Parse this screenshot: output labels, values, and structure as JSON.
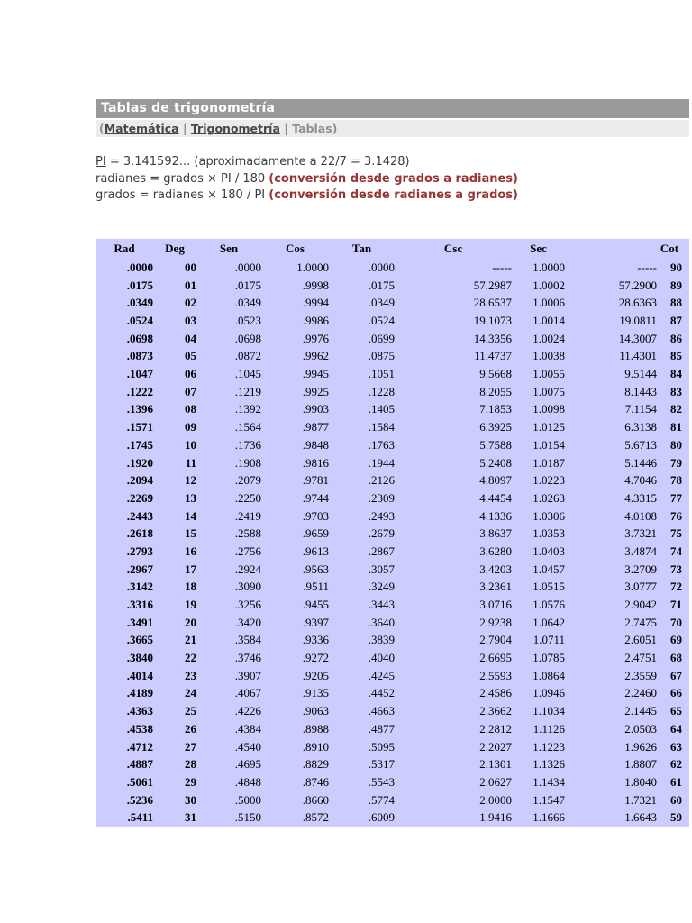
{
  "page": {
    "title": "Tablas de trigonometría"
  },
  "breadcrumb": {
    "open_paren": "(",
    "links": [
      {
        "label": "Matemática"
      },
      {
        "label": "Trigonometría"
      }
    ],
    "separator": " | ",
    "current": "Tablas",
    "close_paren": ")"
  },
  "intro": {
    "pi_link": "PI",
    "pi_rest": " = 3.141592... (aproximadamente a 22/7 = 3.1428)",
    "line2_formula": "radianes = grados × PI / 180 ",
    "line2_note": "(conversión desde grados a radianes)",
    "line3_formula": "grados = radianes × 180 / PI ",
    "line3_note": "(conversión desde radianes a grados)"
  },
  "colors": {
    "title_bar_bg": "#999999",
    "title_text": "#ffffff",
    "breadcrumb_bg": "#ececec",
    "table_bg": "#ccccff",
    "note_red": "#993333",
    "body_text": "#3c3c3c"
  },
  "table": {
    "headers": [
      "Rad",
      "Deg",
      "Sen",
      "Cos",
      "Tan",
      "Csc",
      "Sec",
      "",
      "Cot"
    ],
    "bold_columns": [
      0,
      1,
      8
    ],
    "rows": [
      [
        ".0000",
        "00",
        ".0000",
        "1.0000",
        ".0000",
        "-----",
        "1.0000",
        "-----",
        "90"
      ],
      [
        ".0175",
        "01",
        ".0175",
        ".9998",
        ".0175",
        "57.2987",
        "1.0002",
        "57.2900",
        "89"
      ],
      [
        ".0349",
        "02",
        ".0349",
        ".9994",
        ".0349",
        "28.6537",
        "1.0006",
        "28.6363",
        "88"
      ],
      [
        ".0524",
        "03",
        ".0523",
        ".9986",
        ".0524",
        "19.1073",
        "1.0014",
        "19.0811",
        "87"
      ],
      [
        ".0698",
        "04",
        ".0698",
        ".9976",
        ".0699",
        "14.3356",
        "1.0024",
        "14.3007",
        "86"
      ],
      [
        ".0873",
        "05",
        ".0872",
        ".9962",
        ".0875",
        "11.4737",
        "1.0038",
        "11.4301",
        "85"
      ],
      [
        ".1047",
        "06",
        ".1045",
        ".9945",
        ".1051",
        "9.5668",
        "1.0055",
        "9.5144",
        "84"
      ],
      [
        ".1222",
        "07",
        ".1219",
        ".9925",
        ".1228",
        "8.2055",
        "1.0075",
        "8.1443",
        "83"
      ],
      [
        ".1396",
        "08",
        ".1392",
        ".9903",
        ".1405",
        "7.1853",
        "1.0098",
        "7.1154",
        "82"
      ],
      [
        ".1571",
        "09",
        ".1564",
        ".9877",
        ".1584",
        "6.3925",
        "1.0125",
        "6.3138",
        "81"
      ],
      [
        ".1745",
        "10",
        ".1736",
        ".9848",
        ".1763",
        "5.7588",
        "1.0154",
        "5.6713",
        "80"
      ],
      [
        ".1920",
        "11",
        ".1908",
        ".9816",
        ".1944",
        "5.2408",
        "1.0187",
        "5.1446",
        "79"
      ],
      [
        ".2094",
        "12",
        ".2079",
        ".9781",
        ".2126",
        "4.8097",
        "1.0223",
        "4.7046",
        "78"
      ],
      [
        ".2269",
        "13",
        ".2250",
        ".9744",
        ".2309",
        "4.4454",
        "1.0263",
        "4.3315",
        "77"
      ],
      [
        ".2443",
        "14",
        ".2419",
        ".9703",
        ".2493",
        "4.1336",
        "1.0306",
        "4.0108",
        "76"
      ],
      [
        ".2618",
        "15",
        ".2588",
        ".9659",
        ".2679",
        "3.8637",
        "1.0353",
        "3.7321",
        "75"
      ],
      [
        ".2793",
        "16",
        ".2756",
        ".9613",
        ".2867",
        "3.6280",
        "1.0403",
        "3.4874",
        "74"
      ],
      [
        ".2967",
        "17",
        ".2924",
        ".9563",
        ".3057",
        "3.4203",
        "1.0457",
        "3.2709",
        "73"
      ],
      [
        ".3142",
        "18",
        ".3090",
        ".9511",
        ".3249",
        "3.2361",
        "1.0515",
        "3.0777",
        "72"
      ],
      [
        ".3316",
        "19",
        ".3256",
        ".9455",
        ".3443",
        "3.0716",
        "1.0576",
        "2.9042",
        "71"
      ],
      [
        ".3491",
        "20",
        ".3420",
        ".9397",
        ".3640",
        "2.9238",
        "1.0642",
        "2.7475",
        "70"
      ],
      [
        ".3665",
        "21",
        ".3584",
        ".9336",
        ".3839",
        "2.7904",
        "1.0711",
        "2.6051",
        "69"
      ],
      [
        ".3840",
        "22",
        ".3746",
        ".9272",
        ".4040",
        "2.6695",
        "1.0785",
        "2.4751",
        "68"
      ],
      [
        ".4014",
        "23",
        ".3907",
        ".9205",
        ".4245",
        "2.5593",
        "1.0864",
        "2.3559",
        "67"
      ],
      [
        ".4189",
        "24",
        ".4067",
        ".9135",
        ".4452",
        "2.4586",
        "1.0946",
        "2.2460",
        "66"
      ],
      [
        ".4363",
        "25",
        ".4226",
        ".9063",
        ".4663",
        "2.3662",
        "1.1034",
        "2.1445",
        "65"
      ],
      [
        ".4538",
        "26",
        ".4384",
        ".8988",
        ".4877",
        "2.2812",
        "1.1126",
        "2.0503",
        "64"
      ],
      [
        ".4712",
        "27",
        ".4540",
        ".8910",
        ".5095",
        "2.2027",
        "1.1223",
        "1.9626",
        "63"
      ],
      [
        ".4887",
        "28",
        ".4695",
        ".8829",
        ".5317",
        "2.1301",
        "1.1326",
        "1.8807",
        "62"
      ],
      [
        ".5061",
        "29",
        ".4848",
        ".8746",
        ".5543",
        "2.0627",
        "1.1434",
        "1.8040",
        "61"
      ],
      [
        ".5236",
        "30",
        ".5000",
        ".8660",
        ".5774",
        "2.0000",
        "1.1547",
        "1.7321",
        "60"
      ],
      [
        ".5411",
        "31",
        ".5150",
        ".8572",
        ".6009",
        "1.9416",
        "1.1666",
        "1.6643",
        "59"
      ]
    ]
  }
}
